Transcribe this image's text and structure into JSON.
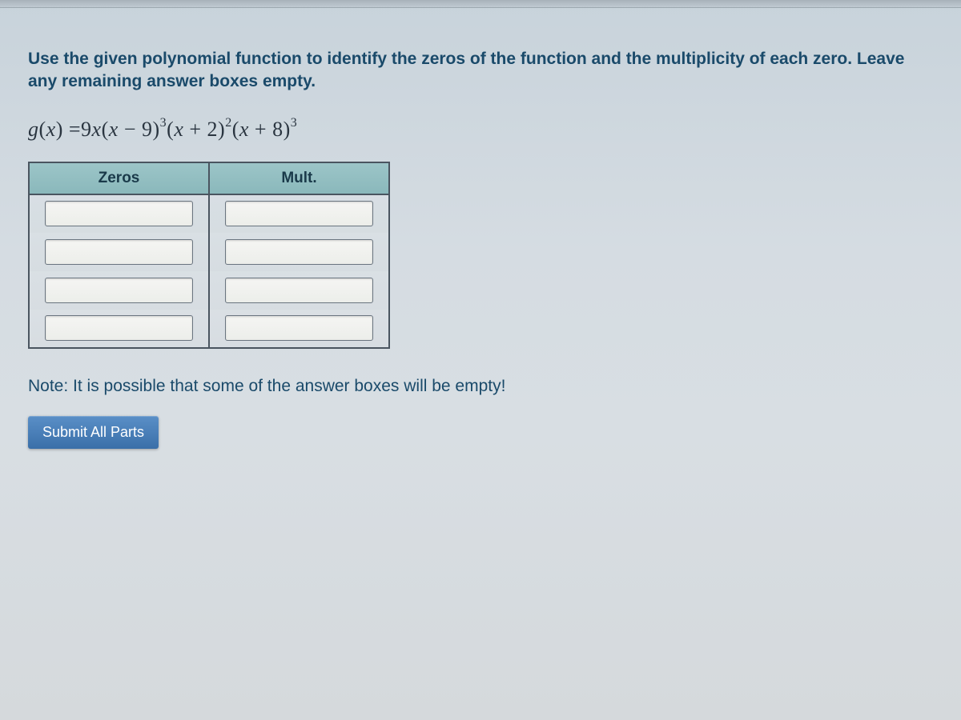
{
  "question": {
    "instructions": "Use the given polynomial function to identify the zeros of the function and the multiplicity of each zero. Leave any remaining answer boxes empty.",
    "equation_text": "g(x) = 9x(x − 9)³(x + 2)²(x + 8)³",
    "table": {
      "headers": {
        "zeros": "Zeros",
        "mult": "Mult."
      },
      "rows": [
        {
          "zero": "",
          "mult": ""
        },
        {
          "zero": "",
          "mult": ""
        },
        {
          "zero": "",
          "mult": ""
        },
        {
          "zero": "",
          "mult": ""
        }
      ]
    },
    "note": "Note: It is possible that some of the answer boxes will be empty!",
    "submit_label": "Submit All Parts"
  }
}
